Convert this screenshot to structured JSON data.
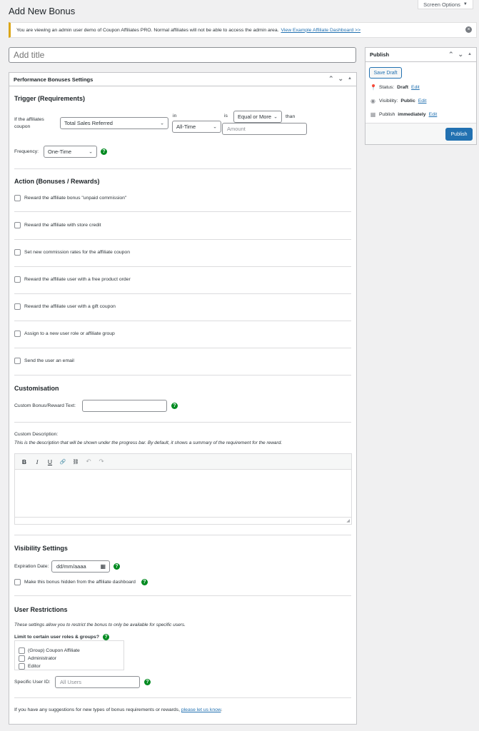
{
  "screen_options": {
    "label": "Screen Options",
    "caret": "▼"
  },
  "page_title": "Add New Bonus",
  "notice": {
    "text": "You are viewing an admin user demo of Coupon Affiliates PRO. Normal affiliates will not be able to access the admin area.",
    "link": "View Example Affiliate Dashboard >>"
  },
  "title_input": {
    "placeholder": "Add title"
  },
  "perf_box": {
    "title": "Performance Bonuses Settings",
    "trigger": {
      "heading": "Trigger (Requirements)",
      "label": "If the affiliates coupon",
      "metric": "Total Sales Referred",
      "in_label": "in",
      "period": "All-Time",
      "is_label": "is",
      "comparison": "Equal or More",
      "than_label": "than",
      "amount_placeholder": "Amount",
      "frequency_label": "Frequency:",
      "frequency": "One-Time"
    },
    "action": {
      "heading": "Action (Bonuses / Rewards)",
      "options": [
        "Reward the affiliate bonus \"unpaid commission\"",
        "Reward the affiliate with store credit",
        "Set new commission rates for the affiliate coupon",
        "Reward the affiliate user with a free product order",
        "Reward the affiliate user with a gift coupon",
        "Assign to a new user role or affiliate group",
        "Send the user an email"
      ]
    },
    "custom": {
      "heading": "Customisation",
      "reward_text_label": "Custom Bonus/Reward Text:",
      "desc_label": "Custom Description:",
      "desc_help": "This is the description that will be shown under the progress bar. By default, it shows a summary of the requirement for the reward.",
      "toolbar": {
        "bold": "B",
        "italic": "I",
        "underline": "U",
        "link": "🔗",
        "unlink": "⛓",
        "undo": "↶",
        "redo": "↷"
      }
    },
    "visibility": {
      "heading": "Visibility Settings",
      "expiry_label": "Expiration Date:",
      "expiry_value": "dd/mm/aaaa",
      "hidden_label": "Make this bonus hidden from the affiliate dashboard"
    },
    "restrictions": {
      "heading": "User Restrictions",
      "help": "These settings allow you to restrict the bonus to only be available for specific users.",
      "roles_label": "Limit to certain user roles & groups?",
      "roles": [
        "(Group) Coupon Affiliate",
        "Administrator",
        "Editor"
      ],
      "user_id_label": "Specific User ID:",
      "user_id_placeholder": "All Users"
    },
    "footer": {
      "text": "If you have any suggestions for new types of bonus requirements or rewards,",
      "link": "please let us know"
    }
  },
  "publish": {
    "title": "Publish",
    "save_draft": "Save Draft",
    "status_label": "Status:",
    "status_value": "Draft",
    "visibility_label": "Visibility:",
    "visibility_value": "Public",
    "publish_label": "Publish",
    "publish_value": "immediately",
    "edit": "Edit",
    "publish_button": "Publish"
  },
  "help_glyph": "?",
  "colors": {
    "primary": "#2271b1",
    "help": "#008a20",
    "notice_border": "#dba617"
  }
}
